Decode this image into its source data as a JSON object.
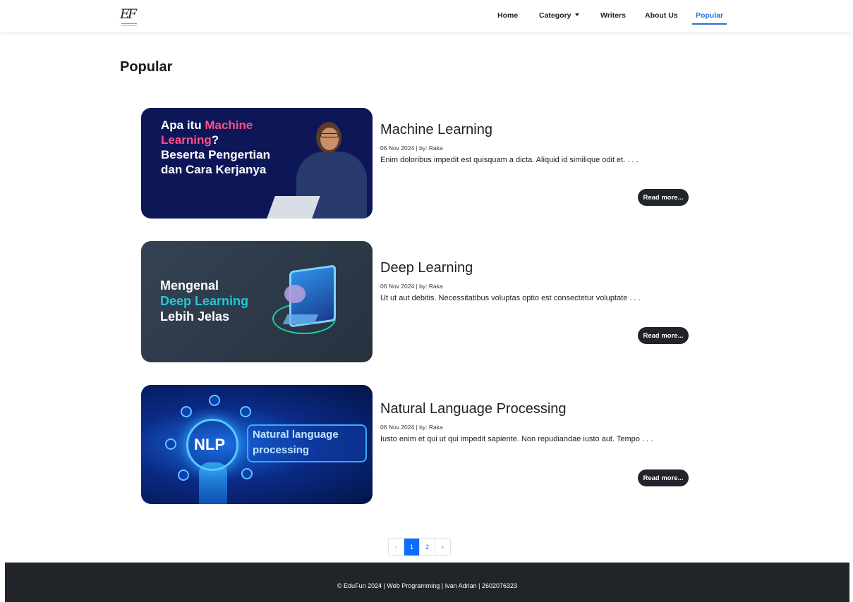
{
  "brand": {
    "logo": "EF"
  },
  "nav": {
    "items": [
      "Home",
      "Category",
      "Writers",
      "About Us",
      "Popular"
    ],
    "active": "Popular"
  },
  "page": {
    "title": "Popular"
  },
  "articles": [
    {
      "title": "Machine Learning",
      "meta": "06 Nov 2024 | by: Raka",
      "excerpt": "Enim doloribus impedit est quisquam a dicta. Aliquid id similique odit et. . . .",
      "button": "Read more...",
      "thumb": {
        "line1a": "Apa itu ",
        "line1b": "Machine",
        "line2a": "Learning",
        "line2b": "?",
        "line3": "Beserta Pengertian",
        "line4": "dan Cara Kerjanya"
      }
    },
    {
      "title": "Deep Learning",
      "meta": "06 Nov 2024 | by: Raka",
      "excerpt": "Ut ut aut debitis. Necessitatibus voluptas optio est consectetur voluptate . . .",
      "button": "Read more...",
      "thumb": {
        "line1": "Mengenal",
        "line2": "Deep Learning",
        "line3": "Lebih Jelas"
      }
    },
    {
      "title": "Natural Language Processing",
      "meta": "06 Nov 2024 | by: Raka",
      "excerpt": "Iusto enim et qui ut qui impedit sapiente. Non repudiandae iusto aut. Tempo . . .",
      "button": "Read more...",
      "thumb": {
        "badge": "NLP",
        "line1": "Natural language",
        "line2": "processing"
      }
    }
  ],
  "pagination": {
    "prev": "‹",
    "pages": [
      "1",
      "2"
    ],
    "active": "1",
    "next": "›"
  },
  "footer": {
    "text": "© EduFun 2024 | Web Programming | Ivan Adrian | 2602076323"
  },
  "colors": {
    "accent": "#2b6fd6",
    "dark": "#212529",
    "pink": "#ff4f8b",
    "teal": "#26c6da"
  }
}
